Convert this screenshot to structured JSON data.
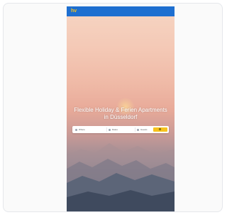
{
  "preview": {
    "logo_text": "hv",
    "hero_title": "Flexible Holiday & Ferien Apartments in Düsseldorf",
    "search": {
      "where_label": "Where",
      "dates_label": "Dates",
      "guests_label": "Guests"
    }
  },
  "colors": {
    "header": "#1e6fd0",
    "accent": "#f6c21c"
  }
}
